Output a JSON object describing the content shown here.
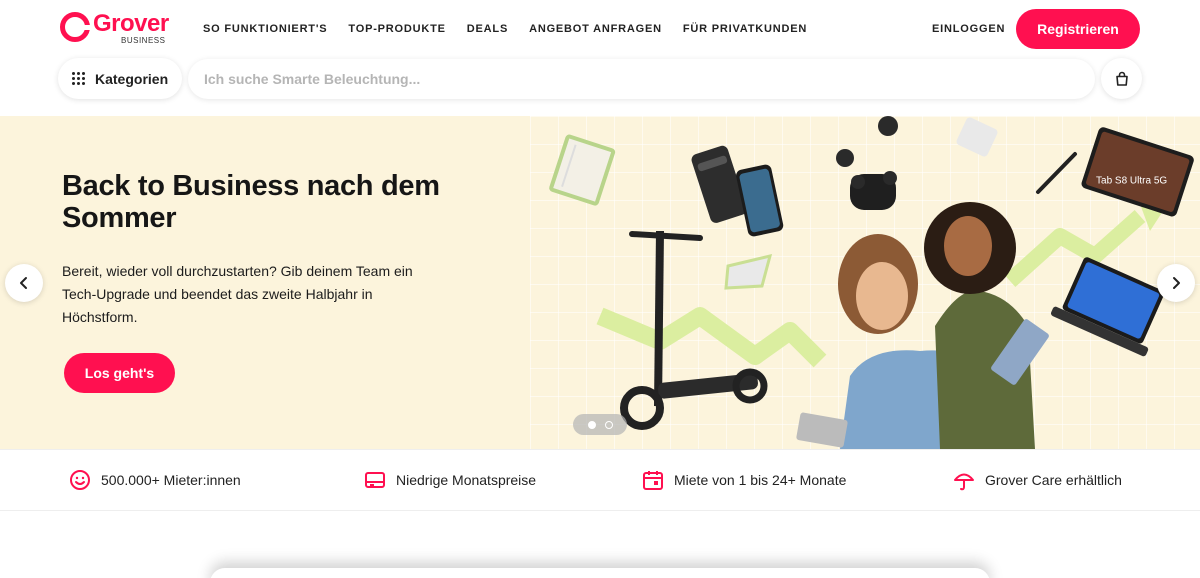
{
  "brand": {
    "name": "Grover",
    "sub": "BUSINESS",
    "accent": "#ff1050"
  },
  "nav": {
    "items": [
      {
        "label": "SO FUNKTIONIERT'S"
      },
      {
        "label": "TOP-PRODUKTE"
      },
      {
        "label": "DEALS"
      },
      {
        "label": "ANGEBOT ANFRAGEN"
      },
      {
        "label": "FÜR PRIVATKUNDEN"
      }
    ],
    "login": "EINLOGGEN",
    "register": "Registrieren"
  },
  "search": {
    "categories_label": "Kategorien",
    "placeholder": "Ich suche Smarte Beleuchtung...",
    "value": ""
  },
  "icons": {
    "categories": "grid-dots-icon",
    "cart": "shopping-bag-icon",
    "prev": "chevron-left-icon",
    "next": "chevron-right-icon"
  },
  "hero": {
    "title": "Back to Business nach dem Sommer",
    "text": "Bereit, wieder voll durchzustarten? Gib deinem Team ein Tech-Upgrade und beendet das zweite Halbjahr in Höchstform.",
    "cta": "Los geht's",
    "background": "#fcf4dc",
    "tablet_text": "Tab S8 Ultra 5G",
    "slides_total": 2,
    "slide_active": 1
  },
  "usp": [
    {
      "icon": "smiley-icon",
      "label": "500.000+ Mieter:innen"
    },
    {
      "icon": "wallet-icon",
      "label": "Niedrige Monatspreise"
    },
    {
      "icon": "calendar-icon",
      "label": "Miete von 1 bis 24+ Monate"
    },
    {
      "icon": "umbrella-icon",
      "label": "Grover Care erhältlich"
    }
  ]
}
